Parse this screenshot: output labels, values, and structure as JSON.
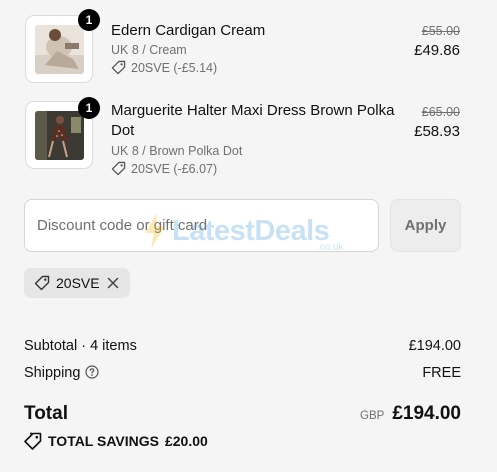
{
  "items": [
    {
      "quantity": "1",
      "title": "Edern Cardigan Cream",
      "variant": "UK 8 / Cream",
      "discount": "20SVE (-£5.14)",
      "original_price": "£55.00",
      "price": "£49.86",
      "image_icon": "product-photo-cardigan"
    },
    {
      "quantity": "1",
      "title": "Marguerite Halter Maxi Dress Brown Polka Dot",
      "variant": "UK 8 / Brown Polka Dot",
      "discount": "20SVE (-£6.07)",
      "original_price": "£65.00",
      "price": "£58.93",
      "image_icon": "product-photo-dress"
    }
  ],
  "discount": {
    "placeholder": "Discount code or gift card",
    "value": "",
    "apply_label": "Apply",
    "applied_code": "20SVE"
  },
  "watermark": {
    "text": "LatestDeals",
    "sub": ".co.uk"
  },
  "summary": {
    "subtotal_label": "Subtotal · 4 items",
    "subtotal_value": "£194.00",
    "shipping_label": "Shipping",
    "shipping_value": "FREE",
    "total_label": "Total",
    "currency": "GBP",
    "total_value": "£194.00",
    "savings_label": "TOTAL SAVINGS",
    "savings_value": "£20.00"
  },
  "colors": {
    "background": "#f5f5f5",
    "muted_text": "#707070",
    "badge": "#000000",
    "chip": "#e6e6e6"
  }
}
